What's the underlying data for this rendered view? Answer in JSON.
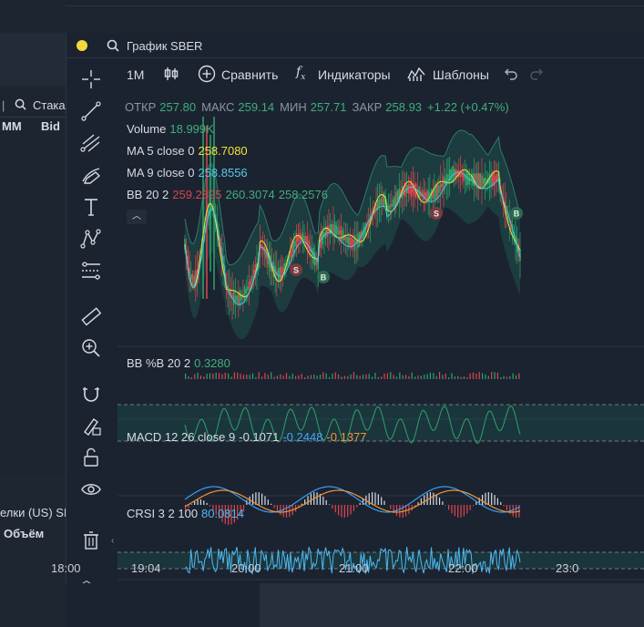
{
  "left_panel": {
    "tab_partial": "Стака",
    "col_mm": "MM",
    "col_bid": "Bid",
    "deals_partial": "елки (US) SB",
    "volume_label": "Объём"
  },
  "window": {
    "title": "График SBER"
  },
  "toolbar": {
    "interval": "1M",
    "compare": "Сравнить",
    "indicators": "Индикаторы",
    "templates": "Шаблоны"
  },
  "ohlc": {
    "open_label": "ОТКР",
    "open": "257.80",
    "high_label": "МАКС",
    "high": "259.14",
    "low_label": "МИН",
    "low": "257.71",
    "close_label": "ЗАКР",
    "close": "258.93",
    "change": "+1.22 (+0.47%)"
  },
  "indicators": {
    "volume": {
      "label": "Volume",
      "value": "18.999K"
    },
    "ma5": {
      "label": "MA 5 close 0",
      "value": "258.7080"
    },
    "ma9": {
      "label": "MA 9 close 0",
      "value": "258.8556"
    },
    "bb": {
      "label": "BB 20 2",
      "v1": "259.2825",
      "v2": "260.3074",
      "v3": "258.2576"
    },
    "bbpb": {
      "label": "BB %B 20 2",
      "value": "0.3280"
    },
    "macd": {
      "label": "MACD 12 26 close 9",
      "v1": "-0.1071",
      "v2": "-0.2448",
      "v3": "-0.1377"
    },
    "crsi": {
      "label": "CRSI 3 2 100",
      "value": "80.0814"
    }
  },
  "markers": {
    "sell": "S",
    "buy": "B"
  },
  "xaxis": [
    "18:00",
    "19:04",
    "20:00",
    "21:00",
    "22:00",
    "23:0"
  ],
  "colors": {
    "up": "#2fa36b",
    "down": "#e0454f",
    "ma5": "#f1e13a",
    "ma9": "#3fc6e0",
    "bb_upper": "#d6dbe2",
    "bb_band": "#1e5a52",
    "macd_line": "#3b9df0",
    "signal": "#f0953b",
    "crsi": "#4fb8f0",
    "legend_green": "#3fae7b",
    "legend_yellow": "#f1e13a",
    "legend_cyan": "#58c7e6",
    "legend_red": "#d64550",
    "legend_blue": "#4aa3f0",
    "legend_orange": "#f0953b"
  }
}
